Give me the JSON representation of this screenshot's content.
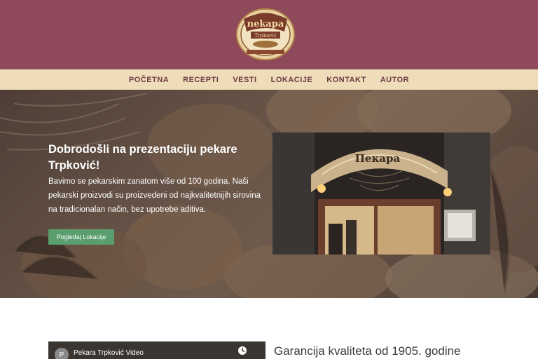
{
  "header": {
    "logo": {
      "icon": "bakery-logo-icon",
      "text_top": "Nekara",
      "text_bottom": "Trpković"
    }
  },
  "nav": {
    "items": [
      {
        "label": "POČETNA"
      },
      {
        "label": "RECEPTI"
      },
      {
        "label": "VESTI"
      },
      {
        "label": "LOKACIJE"
      },
      {
        "label": "KONTAKT"
      },
      {
        "label": "AUTOR"
      }
    ]
  },
  "hero": {
    "title": "Dobrodošli na prezentaciju pekare Trpković!",
    "text": "Bavimo se pekarskim zanatom više od 100 godina. Naši pekarski proizvodi su proizvedeni od najkvalitetnijih sirovina na tradicionalan način, bez upotrebe aditiva.",
    "button_label": "Pogledaj Lokacije",
    "photo_sign": "Пекара"
  },
  "video": {
    "avatar_letter": "P",
    "title": "Pekara Trpković Video"
  },
  "section": {
    "title": "Garancija kvaliteta od 1905. godine"
  },
  "colors": {
    "header_bg": "#8e4a5b",
    "nav_bg": "#efdcb8",
    "nav_text": "#6d3c44",
    "button_bg": "#5a9e6f"
  }
}
